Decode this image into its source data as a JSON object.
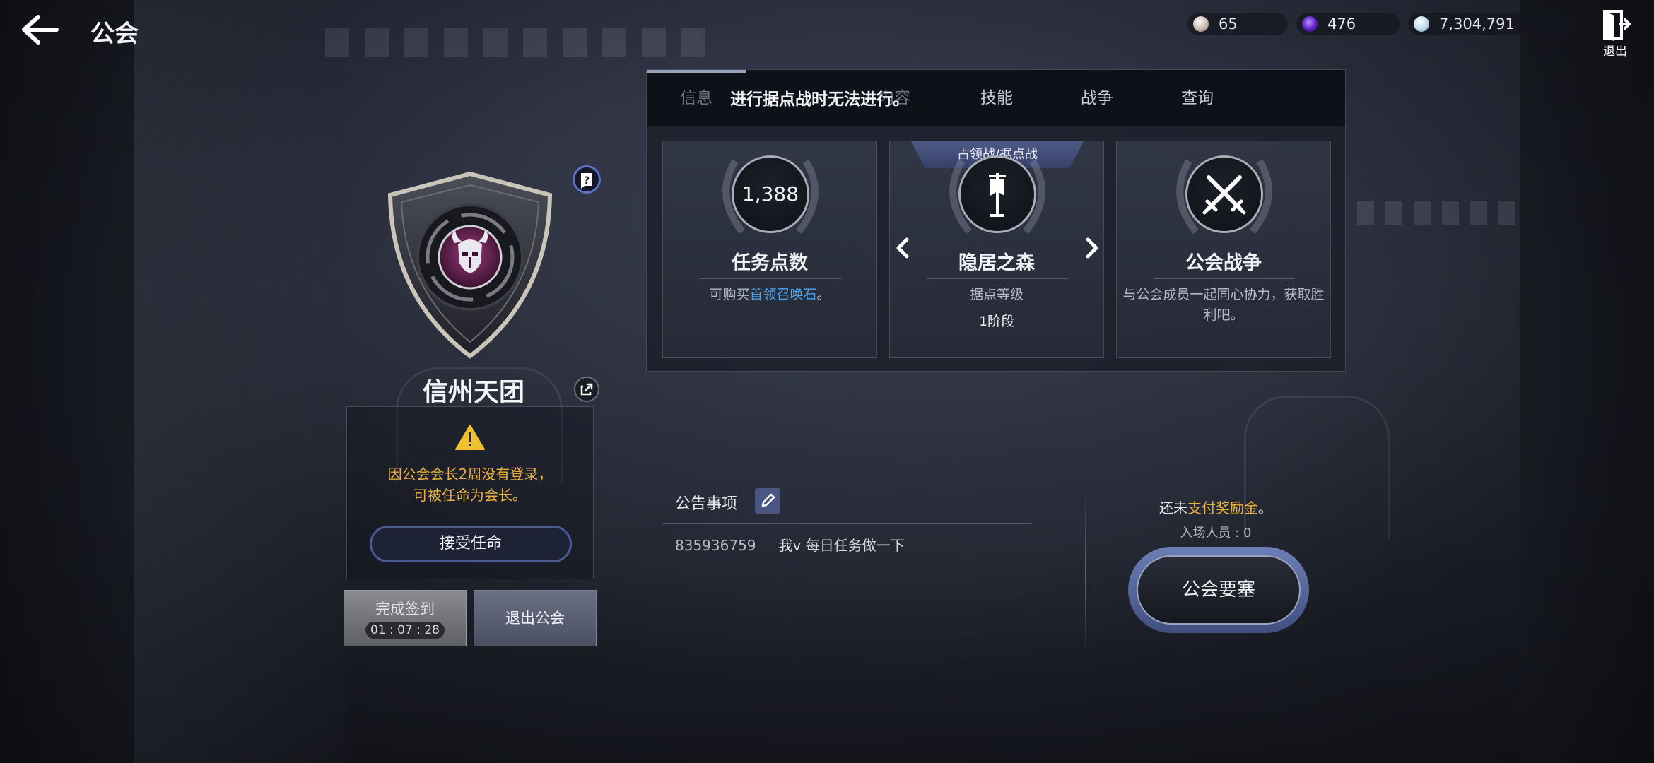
{
  "header": {
    "title": "公会",
    "exit_label": "退出"
  },
  "currencies": [
    {
      "name": "pearl",
      "value": "65",
      "color": "#d9c9c0"
    },
    {
      "name": "purple-gem",
      "value": "476",
      "color": "#6b2fd1"
    },
    {
      "name": "silver",
      "value": "7,304,791",
      "color": "#b8d6e8"
    }
  ],
  "guild": {
    "name": "信州天团",
    "notice_line1": "因公会会长2周没有登录，",
    "notice_line2": "可被任命为会长。",
    "accept_label": "接受任命",
    "checkin_label": "完成签到",
    "checkin_timer": "01 : 07 : 28",
    "leave_label": "退出公会"
  },
  "panel": {
    "tabs": [
      {
        "label": "信息",
        "state": "active-dim"
      },
      {
        "label": "内容",
        "state": "dim"
      },
      {
        "label": "技能",
        "state": "normal"
      },
      {
        "label": "战争",
        "state": "normal"
      },
      {
        "label": "查询",
        "state": "normal"
      }
    ],
    "tab_notice": "进行据点战时无法进行。",
    "cards": {
      "mission": {
        "value": "1,388",
        "title": "任务点数",
        "sub_prefix": "可购买",
        "sub_link": "首领召唤石",
        "sub_suffix": "。"
      },
      "stronghold": {
        "badge": "占领战/据点战",
        "title": "隐居之森",
        "sub": "据点等级",
        "stage": "1阶段"
      },
      "war": {
        "title": "公会战争",
        "sub": "与公会成员一起同心协力，获取胜利吧。"
      }
    }
  },
  "announcement": {
    "title": "公告事项",
    "author": "835936759",
    "message": "我v 每日任务做一下"
  },
  "fortress": {
    "reward_prefix": "还未",
    "reward_gold": "支付奖励金",
    "reward_suffix": "。",
    "entry": "入场人员 : 0",
    "button_label": "公会要塞"
  }
}
